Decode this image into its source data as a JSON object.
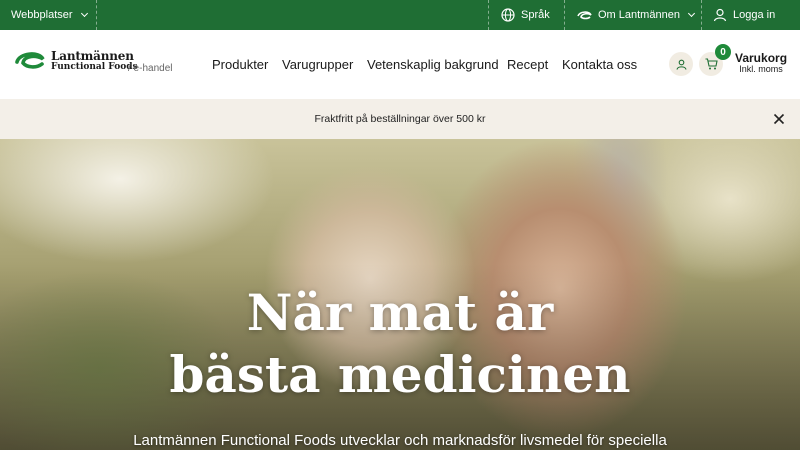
{
  "topbar": {
    "websites_label": "Webbplatser",
    "language_label": "Språk",
    "about_label": "Om Lantmännen",
    "login_label": "Logga in"
  },
  "header": {
    "logo_name": "Lantmännen",
    "logo_sub": "Functional Foods",
    "ehandel": "/ e-handel",
    "nav": [
      "Produkter",
      "Varugrupper",
      "Vetenskaplig bakgrund",
      "Recept",
      "Kontakta oss"
    ],
    "cart_count": "0",
    "cart_title": "Varukorg",
    "cart_sub": "Inkl. moms"
  },
  "notice": {
    "text": "Fraktfritt på beställningar över 500 kr"
  },
  "hero": {
    "title_line1": "När mat är",
    "title_line2": "bästa medicinen",
    "subtitle": "Lantmännen Functional Foods utvecklar och marknadsför livsmedel för speciella"
  },
  "colors": {
    "brand_green": "#1f6e34",
    "badge_green": "#1f8a3a",
    "notice_bg": "#f3efe8"
  }
}
